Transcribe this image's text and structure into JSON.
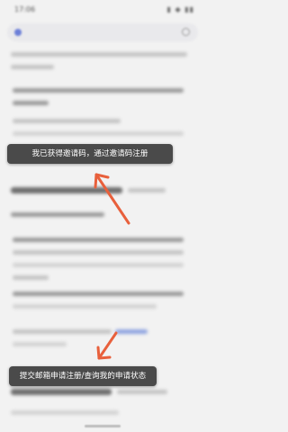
{
  "status": {
    "time": "17:06",
    "icons": "▮ ◆ ▮▮"
  },
  "colors": {
    "arrow": "#e8603c",
    "tooltip_bg": "#4a4a4a",
    "tooltip_text": "#ffffff"
  },
  "tooltips": {
    "invite_code": "我已获得邀请码，通过邀请码注册",
    "email_apply": "提交邮箱申请注册/查询我的申请状态"
  },
  "icons": {
    "search": "search-icon",
    "arrow": "arrow-icon"
  }
}
